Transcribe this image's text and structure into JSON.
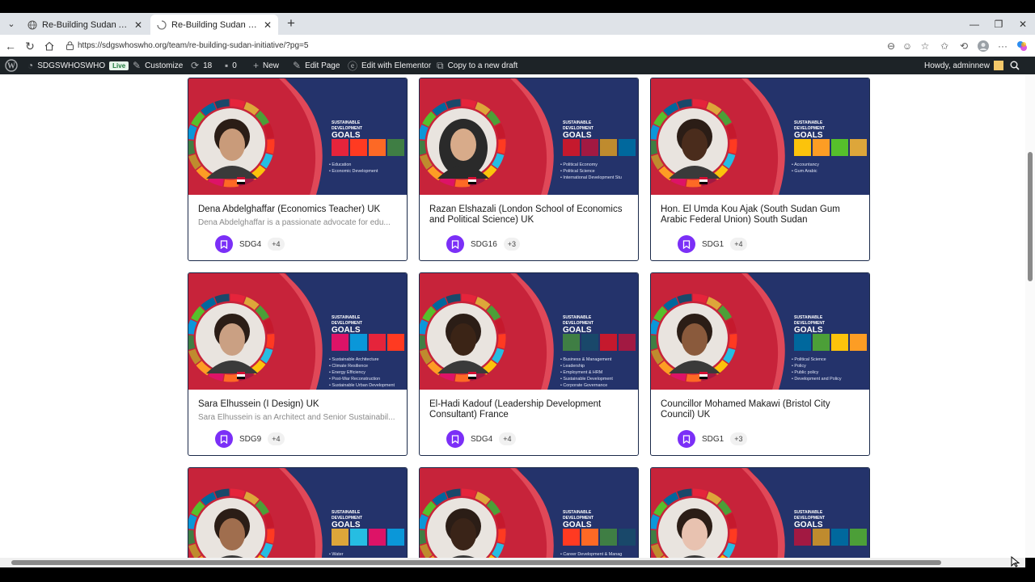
{
  "browser": {
    "tabs": [
      {
        "title": "Re-Building Sudan After the War (",
        "active": false
      },
      {
        "title": "Re-Building Sudan Initiative – SDG",
        "active": true
      }
    ],
    "url": "https://sdgswhoswho.org/team/re-building-sudan-initiative/?pg=5"
  },
  "wp_admin_bar": {
    "site_name": "SDGSWHOSWHO",
    "live_label": "Live",
    "customize": "Customize",
    "updates_count": "18",
    "comments_count": "0",
    "new": "New",
    "edit_page": "Edit Page",
    "edit_elementor": "Edit with Elementor",
    "copy_draft": "Copy to a new draft",
    "howdy": "Howdy, adminnew"
  },
  "banner_text": {
    "heading_line1": "SUSTAINABLE",
    "heading_line2": "DEVELOPMENT",
    "heading_line3": "GOALS"
  },
  "cards": [
    {
      "name": "Dena Abdelghaffar (Economics Teacher) UK",
      "desc": "Dena Abdelghaffar is a passionate advocate for edu...",
      "sdg": "SDG4",
      "more": "+4",
      "banner_lines": [
        "• Education",
        "• Economic Development"
      ],
      "skin": "#c99b7a",
      "hijab": false
    },
    {
      "name": "Razan Elshazali (London School of Economics and Political Science) UK",
      "desc": "",
      "sdg": "SDG16",
      "more": "+3",
      "banner_lines": [
        "• Political Economy",
        "• Political Science",
        "• International Development Stu"
      ],
      "skin": "#d8ab8a",
      "hijab": true
    },
    {
      "name": "Hon. El Umda Kou Ajak (South Sudan Gum Arabic Federal Union) South Sudan",
      "desc": "",
      "sdg": "SDG1",
      "more": "+4",
      "banner_lines": [
        "• Accountancy",
        "• Gum Arabic"
      ],
      "skin": "#4a2c1c",
      "hijab": false
    },
    {
      "name": "Sara Elhussein (I Design) UK",
      "desc": "Sara Elhussein is an Architect and Senior Sustainabil...",
      "sdg": "SDG9",
      "more": "+4",
      "banner_lines": [
        "• Sustainable Architecture",
        "• Climate Resilience",
        "• Energy Efficiency",
        "• Post-War Reconstruction",
        "• Sustainable Urban Development"
      ],
      "skin": "#caa083",
      "hijab": false
    },
    {
      "name": "El-Hadi Kadouf (Leadership Development Consultant) France",
      "desc": "",
      "sdg": "SDG4",
      "more": "+4",
      "banner_lines": [
        "• Business & Management",
        "• Leadership",
        "• Employment & HRM",
        "• Sustainable Development",
        "• Corporate Governance"
      ],
      "skin": "#3b2416",
      "hijab": false
    },
    {
      "name": "Councillor Mohamed Makawi (Bristol City Council) UK",
      "desc": "",
      "sdg": "SDG1",
      "more": "+3",
      "banner_lines": [
        "• Political Science",
        "• Policy",
        "• Public policy",
        "• Development and Policy"
      ],
      "skin": "#8a5a3c",
      "hijab": false
    },
    {
      "name": "",
      "desc": "",
      "sdg": "",
      "more": "",
      "banner_lines": [
        "• Water"
      ],
      "skin": "#a06e4e",
      "hijab": false
    },
    {
      "name": "",
      "desc": "",
      "sdg": "",
      "more": "",
      "banner_lines": [
        "• Career Development & Manag"
      ],
      "skin": "#3a2418",
      "hijab": false
    },
    {
      "name": "",
      "desc": "",
      "sdg": "",
      "more": "",
      "banner_lines": [],
      "skin": "#e8c2b0",
      "hijab": false
    }
  ]
}
